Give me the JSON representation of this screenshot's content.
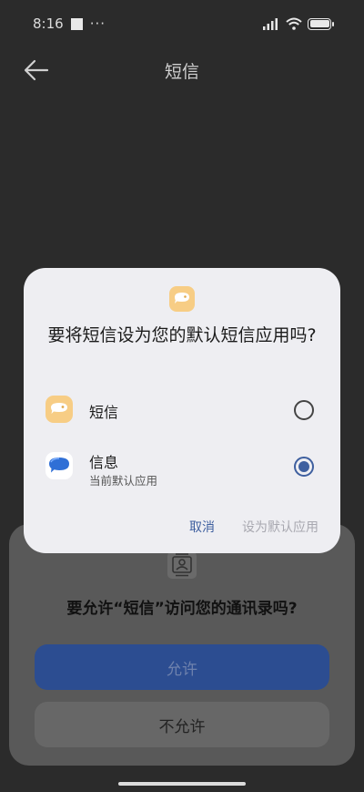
{
  "status_bar": {
    "time": "8:16",
    "dots": "···"
  },
  "app_bar": {
    "title": "短信"
  },
  "permission_sheet": {
    "title": "要允许“短信”访问您的通讯录吗?",
    "allow_label": "允许",
    "deny_label": "不允许"
  },
  "dialog": {
    "title": "要将短信设为您的默认短信应用吗?",
    "options": [
      {
        "label": "短信",
        "sublabel": "",
        "selected": false
      },
      {
        "label": "信息",
        "sublabel": "当前默认应用",
        "selected": true
      }
    ],
    "cancel_label": "取消",
    "set_default_label": "设为默认应用"
  },
  "colors": {
    "accent": "#3e5f9f",
    "sms_icon": "#f7cd85",
    "messages_icon": "#2f6fd6"
  },
  "icons": {
    "back": "arrow-left-icon",
    "sms": "sms-app-icon",
    "messages": "messages-app-icon",
    "contacts": "contact-card-icon",
    "battery": "battery-icon",
    "wifi": "wifi-icon",
    "signal": "signal-icon"
  }
}
